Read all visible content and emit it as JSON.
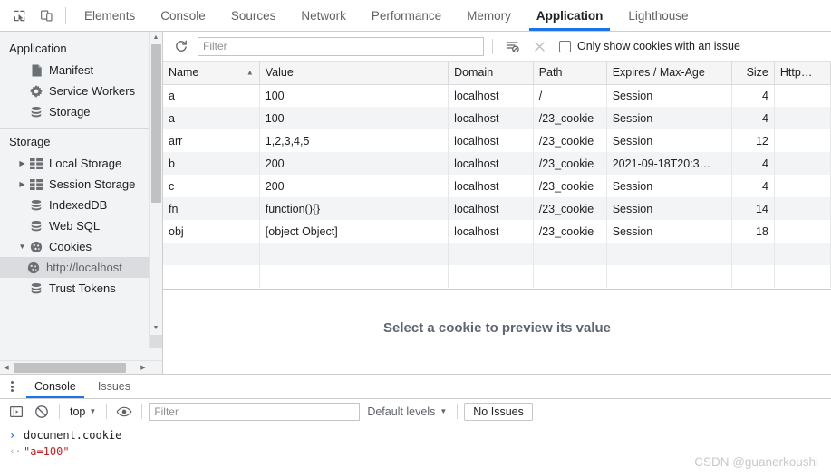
{
  "topbar": {
    "icons": [
      {
        "name": "inspect-element-icon",
        "glyph": "inspect"
      },
      {
        "name": "device-toolbar-icon",
        "glyph": "device"
      }
    ],
    "tabs": [
      {
        "label": "Elements",
        "selected": false
      },
      {
        "label": "Console",
        "selected": false
      },
      {
        "label": "Sources",
        "selected": false
      },
      {
        "label": "Network",
        "selected": false
      },
      {
        "label": "Performance",
        "selected": false
      },
      {
        "label": "Memory",
        "selected": false
      },
      {
        "label": "Application",
        "selected": true
      },
      {
        "label": "Lighthouse",
        "selected": false
      }
    ],
    "accent_color": "#1a73e8"
  },
  "sidebar": {
    "sections": [
      {
        "title": "Application",
        "items": [
          {
            "label": "Manifest",
            "icon": "document-icon",
            "expandable": false,
            "selected": false
          },
          {
            "label": "Service Workers",
            "icon": "gear-icon",
            "expandable": false,
            "selected": false
          },
          {
            "label": "Storage",
            "icon": "database-icon",
            "expandable": false,
            "selected": false
          }
        ]
      },
      {
        "title": "Storage",
        "items": [
          {
            "label": "Local Storage",
            "icon": "table-icon",
            "expandable": true,
            "expanded": false,
            "selected": false
          },
          {
            "label": "Session Storage",
            "icon": "table-icon",
            "expandable": true,
            "expanded": false,
            "selected": false
          },
          {
            "label": "IndexedDB",
            "icon": "database-icon",
            "expandable": false,
            "selected": false
          },
          {
            "label": "Web SQL",
            "icon": "database-icon",
            "expandable": false,
            "selected": false
          },
          {
            "label": "Cookies",
            "icon": "cookie-icon",
            "expandable": true,
            "expanded": true,
            "selected": false
          },
          {
            "label": "http://localhost",
            "icon": "cookie-icon",
            "expandable": false,
            "selected": true,
            "child": true
          },
          {
            "label": "Trust Tokens",
            "icon": "database-icon",
            "expandable": false,
            "selected": false
          }
        ]
      }
    ]
  },
  "toolbar": {
    "refresh_icon": "refresh-icon",
    "filter_placeholder": "Filter",
    "filter_value": "",
    "clear_filtered_icon": "clear-filtered-cookies-icon",
    "clear_all_icon": "clear-all-cookies-icon",
    "only_issues_label": "Only show cookies with an issue",
    "only_issues_checked": false
  },
  "table": {
    "columns": [
      {
        "label": "Name",
        "sorted": true,
        "sort_dir": "asc",
        "align": "left"
      },
      {
        "label": "Value",
        "align": "left"
      },
      {
        "label": "Domain",
        "align": "left"
      },
      {
        "label": "Path",
        "align": "left"
      },
      {
        "label": "Expires / Max-Age",
        "align": "left"
      },
      {
        "label": "Size",
        "align": "right"
      },
      {
        "label": "Http…",
        "align": "left"
      }
    ],
    "rows": [
      {
        "name": "a",
        "value": "100",
        "domain": "localhost",
        "path": "/",
        "expires": "Session",
        "size": "4",
        "http": ""
      },
      {
        "name": "a",
        "value": "100",
        "domain": "localhost",
        "path": "/23_cookie",
        "expires": "Session",
        "size": "4",
        "http": ""
      },
      {
        "name": "arr",
        "value": "1,2,3,4,5",
        "domain": "localhost",
        "path": "/23_cookie",
        "expires": "Session",
        "size": "12",
        "http": ""
      },
      {
        "name": "b",
        "value": "200",
        "domain": "localhost",
        "path": "/23_cookie",
        "expires": "2021-09-18T20:3…",
        "size": "4",
        "http": ""
      },
      {
        "name": "c",
        "value": "200",
        "domain": "localhost",
        "path": "/23_cookie",
        "expires": "Session",
        "size": "4",
        "http": ""
      },
      {
        "name": "fn",
        "value": "function(){}",
        "domain": "localhost",
        "path": "/23_cookie",
        "expires": "Session",
        "size": "14",
        "http": ""
      },
      {
        "name": "obj",
        "value": "[object Object]",
        "domain": "localhost",
        "path": "/23_cookie",
        "expires": "Session",
        "size": "18",
        "http": ""
      },
      {
        "name": "",
        "value": "",
        "domain": "",
        "path": "",
        "expires": "",
        "size": "",
        "http": ""
      },
      {
        "name": "",
        "value": "",
        "domain": "",
        "path": "",
        "expires": "",
        "size": "",
        "http": ""
      }
    ]
  },
  "preview": {
    "empty_message": "Select a cookie to preview its value"
  },
  "drawer": {
    "tabs": [
      {
        "label": "Console",
        "selected": true
      },
      {
        "label": "Issues",
        "selected": false
      }
    ],
    "console_toolbar": {
      "sidebar_icon": "console-sidebar-icon",
      "clear_icon": "clear-console-icon",
      "context": "top",
      "eye_icon": "live-expression-icon",
      "filter_placeholder": "Filter",
      "filter_value": "",
      "levels_label": "Default levels",
      "issues_button": "No Issues"
    },
    "console_lines": [
      {
        "kind": "input",
        "marker": "›",
        "text": "document.cookie"
      },
      {
        "kind": "output",
        "marker": "‹·",
        "text": "\"a=100\""
      }
    ]
  },
  "watermark": {
    "text": "CSDN @guanerkoushi"
  }
}
